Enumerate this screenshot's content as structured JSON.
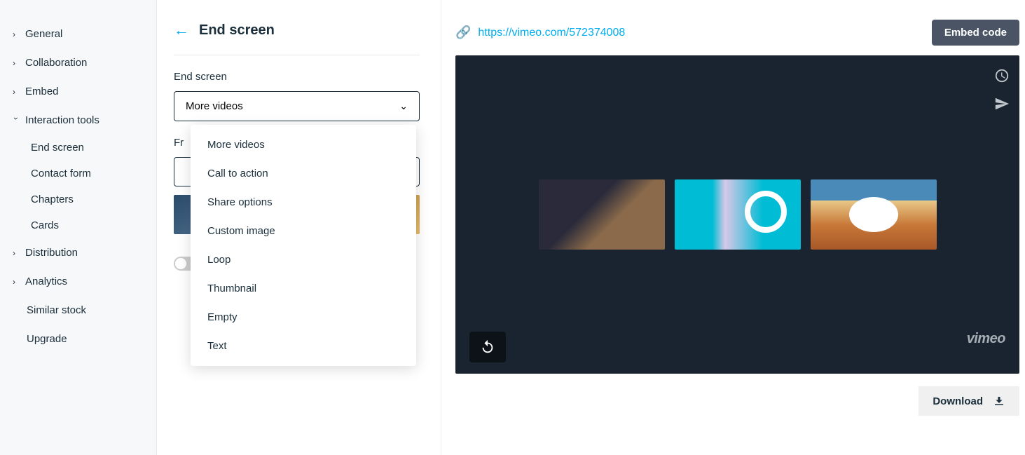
{
  "sidebar": {
    "items": [
      {
        "label": "General",
        "expandable": true,
        "expanded": false
      },
      {
        "label": "Collaboration",
        "expandable": true,
        "expanded": false
      },
      {
        "label": "Embed",
        "expandable": true,
        "expanded": false
      },
      {
        "label": "Interaction tools",
        "expandable": true,
        "expanded": true,
        "children": [
          {
            "label": "End screen"
          },
          {
            "label": "Contact form"
          },
          {
            "label": "Chapters"
          },
          {
            "label": "Cards"
          }
        ]
      },
      {
        "label": "Distribution",
        "expandable": true,
        "expanded": false
      },
      {
        "label": "Analytics",
        "expandable": true,
        "expanded": false
      }
    ],
    "plain_items": [
      {
        "label": "Similar stock"
      },
      {
        "label": "Upgrade"
      }
    ]
  },
  "panel": {
    "title": "End screen",
    "field_label": "End screen",
    "selected_value": "More videos",
    "second_label_prefix": "Fr",
    "dropdown_options": [
      "More videos",
      "Call to action",
      "Share options",
      "Custom image",
      "Loop",
      "Thumbnail",
      "Empty",
      "Text"
    ]
  },
  "preview": {
    "url": "https://vimeo.com/572374008",
    "embed_button": "Embed code",
    "download_button": "Download",
    "logo_text": "vimeo"
  }
}
